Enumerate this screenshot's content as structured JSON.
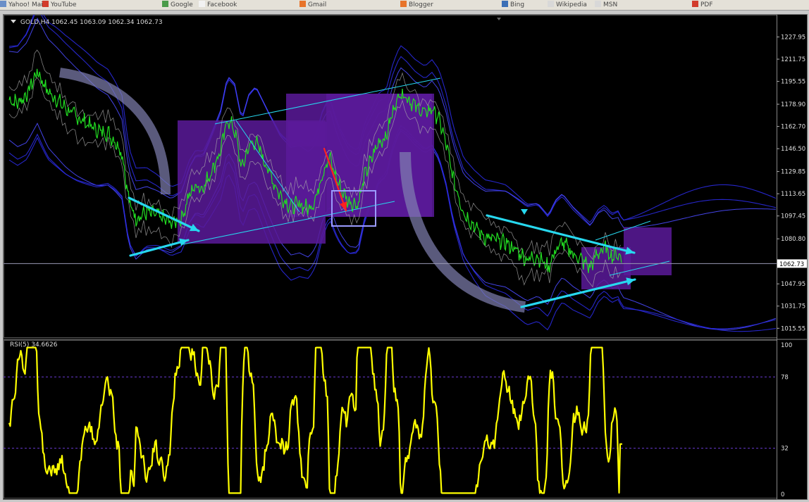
{
  "browser_tabs": [
    {
      "label": "Yahoo! Mail",
      "icon": "mail-icon",
      "color": "#6b8fc8"
    },
    {
      "label": "YouTube",
      "icon": "youtube-icon",
      "color": "#d23b2b"
    },
    {
      "label": "Google",
      "icon": "google-icon",
      "color": "#4a9b4a"
    },
    {
      "label": "Facebook",
      "icon": "page-icon",
      "color": "#f2f2f2"
    },
    {
      "label": "Gmail",
      "icon": "blogger-icon",
      "color": "#e8742a"
    },
    {
      "label": "Blogger",
      "icon": "blogger-icon",
      "color": "#e8742a"
    },
    {
      "label": "Bing",
      "icon": "bing-icon",
      "color": "#3b6fb6"
    },
    {
      "label": "Wikipedia",
      "icon": "page-icon",
      "color": "#d8d8d8"
    },
    {
      "label": "MSN",
      "icon": "page-icon",
      "color": "#d8d8d8"
    },
    {
      "label": "PDF",
      "icon": "pdf-icon",
      "color": "#d23b2b"
    }
  ],
  "chart": {
    "symbol_line": "GOLD,H4  1062.45 1063.09 1062.34 1062.73",
    "current_price_label": "1062.73",
    "rsi_label": "RSI(5) 34.6626",
    "colors": {
      "background": "#000000",
      "price_line": "#22dd22",
      "rsi_line": "#ffff00",
      "bands": "#2a2adf",
      "envelope": "#aaaaaa",
      "zones": "#5a1a9a",
      "trendlines": "#27d8ef",
      "arrow_red": "#ff2020",
      "arc": "#8080b0"
    }
  },
  "chart_data": {
    "type": "line",
    "title": "GOLD,H4",
    "ohlc": {
      "open": 1062.45,
      "high": 1063.09,
      "low": 1062.34,
      "close": 1062.73
    },
    "price_axis": {
      "ticks": [
        "1227.95",
        "1211.75",
        "1195.55",
        "1178.90",
        "1162.70",
        "1146.50",
        "1129.85",
        "1113.65",
        "1097.45",
        "1080.80",
        "1062.73",
        "1047.95",
        "1031.75",
        "1015.55"
      ],
      "range": [
        1008.0,
        1240.0
      ]
    },
    "price_series_anchors": [
      [
        0,
        1182
      ],
      [
        12,
        1180
      ],
      [
        25,
        1186
      ],
      [
        40,
        1203
      ],
      [
        55,
        1188
      ],
      [
        68,
        1182
      ],
      [
        80,
        1176
      ],
      [
        95,
        1170
      ],
      [
        110,
        1165
      ],
      [
        125,
        1160
      ],
      [
        140,
        1158
      ],
      [
        150,
        1152
      ],
      [
        160,
        1144
      ],
      [
        170,
        1108
      ],
      [
        180,
        1096
      ],
      [
        195,
        1100
      ],
      [
        210,
        1098
      ],
      [
        230,
        1092
      ],
      [
        245,
        1096
      ],
      [
        255,
        1112
      ],
      [
        265,
        1120
      ],
      [
        275,
        1118
      ],
      [
        285,
        1128
      ],
      [
        300,
        1145
      ],
      [
        310,
        1168
      ],
      [
        320,
        1160
      ],
      [
        330,
        1132
      ],
      [
        340,
        1148
      ],
      [
        350,
        1152
      ],
      [
        360,
        1140
      ],
      [
        370,
        1128
      ],
      [
        385,
        1112
      ],
      [
        400,
        1104
      ],
      [
        412,
        1106
      ],
      [
        425,
        1103
      ],
      [
        435,
        1110
      ],
      [
        445,
        1130
      ],
      [
        455,
        1140
      ],
      [
        462,
        1128
      ],
      [
        470,
        1118
      ],
      [
        482,
        1108
      ],
      [
        495,
        1106
      ],
      [
        505,
        1128
      ],
      [
        515,
        1140
      ],
      [
        525,
        1152
      ],
      [
        535,
        1155
      ],
      [
        545,
        1175
      ],
      [
        555,
        1188
      ],
      [
        565,
        1184
      ],
      [
        575,
        1178
      ],
      [
        590,
        1172
      ],
      [
        600,
        1176
      ],
      [
        610,
        1168
      ],
      [
        620,
        1150
      ],
      [
        630,
        1125
      ],
      [
        645,
        1100
      ],
      [
        660,
        1090
      ],
      [
        675,
        1082
      ],
      [
        690,
        1080
      ],
      [
        705,
        1078
      ],
      [
        720,
        1072
      ],
      [
        735,
        1066
      ],
      [
        750,
        1068
      ],
      [
        765,
        1060
      ],
      [
        775,
        1072
      ],
      [
        785,
        1078
      ],
      [
        800,
        1070
      ],
      [
        815,
        1064
      ],
      [
        825,
        1060
      ],
      [
        835,
        1070
      ],
      [
        845,
        1074
      ],
      [
        855,
        1068
      ],
      [
        865,
        1070
      ],
      [
        870,
        1062.73
      ]
    ],
    "rsi_axis": {
      "ticks": [
        "100",
        "78",
        "32",
        "0"
      ],
      "levels": [
        78,
        32
      ],
      "range": [
        0,
        100
      ]
    },
    "rsi_value": 34.6626,
    "annotations": [
      "purple zone rectangles",
      "cyan trendlines and arrows",
      "red arrow",
      "translucent arc"
    ]
  }
}
